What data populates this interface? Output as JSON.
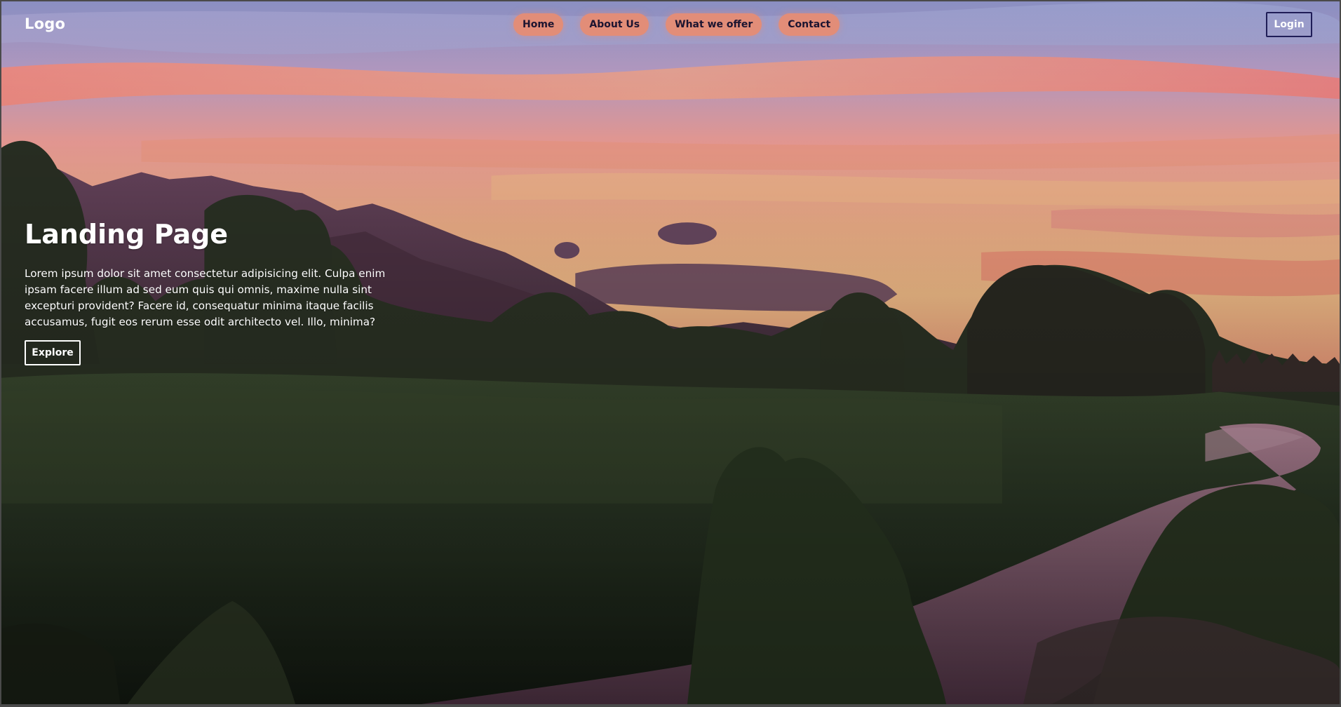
{
  "navbar": {
    "logo_text": "Logo",
    "links": [
      {
        "label": "Home"
      },
      {
        "label": "About Us"
      },
      {
        "label": "What we offer"
      },
      {
        "label": "Contact"
      }
    ],
    "login_label": "Login"
  },
  "hero": {
    "title": "Landing Page",
    "text": "Lorem ipsum dolor sit amet consectetur adipisicing elit. Culpa enim ipsam facere illum ad sed eum quis qui omnis, maxime nulla sint excepturi provident? Facere id, consequatur minima itaque facilis accusamus, fugit eos rerum esse odit architecto vel. Illo, minima?",
    "button_label": "Explore"
  },
  "colors": {
    "nav_pill": "#e28d78",
    "nav_pill_text": "#1c1430",
    "login_border": "#1f1d57",
    "text": "#ffffff"
  }
}
